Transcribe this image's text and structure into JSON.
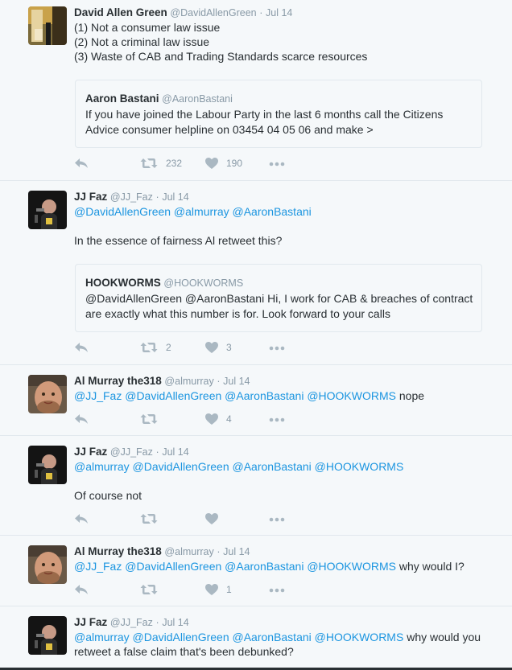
{
  "tweets": [
    {
      "name": "David Allen Green",
      "handle": "@DavidAllenGreen",
      "date": "Jul 14",
      "lines": [
        "(1) Not a consumer law issue",
        "(2) Not a criminal law issue",
        "(3) Waste of CAB and Trading Standards scarce resources"
      ],
      "quote": {
        "name": "Aaron Bastani",
        "handle": "@AaronBastani",
        "lines": [
          "If you have joined the Labour Party in the last 6 months call the Citizens",
          "Advice consumer helpline on 03454 04 05 06 and make >"
        ]
      },
      "retweets": "232",
      "likes": "190"
    },
    {
      "name": "JJ Faz",
      "handle": "@JJ_Faz",
      "date": "Jul 14",
      "mentions": "@DavidAllenGreen @almurray @AaronBastani",
      "text": "In the essence of fairness Al retweet this?",
      "quote": {
        "name": "HOOKWORMS",
        "handle": "@HOOKWORMS",
        "lines": [
          "@DavidAllenGreen @AaronBastani Hi, I work for CAB & breaches of contract",
          "are exactly what this number is for. Look forward to your calls"
        ]
      },
      "retweets": "2",
      "likes": "3"
    },
    {
      "name": "Al Murray the318",
      "handle": "@almurray",
      "date": "Jul 14",
      "mentions": "@JJ_Faz @DavidAllenGreen @AaronBastani @HOOKWORMS",
      "text": "nope",
      "retweets": "",
      "likes": "4"
    },
    {
      "name": "JJ Faz",
      "handle": "@JJ_Faz",
      "date": "Jul 14",
      "mentions": "@almurray @DavidAllenGreen @AaronBastani @HOOKWORMS",
      "text": "Of course not",
      "retweets": "",
      "likes": ""
    },
    {
      "name": "Al Murray the318",
      "handle": "@almurray",
      "date": "Jul 14",
      "mentions": "@JJ_Faz @DavidAllenGreen @AaronBastani @HOOKWORMS",
      "text": "why would I?",
      "retweets": "",
      "likes": "1"
    },
    {
      "name": "JJ Faz",
      "handle": "@JJ_Faz",
      "date": "Jul 14",
      "mentions": "@almurray @DavidAllenGreen @AaronBastani @HOOKWORMS",
      "text": "why would you",
      "text_line2": "retweet a false claim that's been debunked?"
    }
  ],
  "separator": "·",
  "colors": {
    "link": "#1b95e0",
    "muted": "#8899a6",
    "icon": "#aab8c2",
    "border": "#e1e8ed"
  },
  "icons": [
    "reply-icon",
    "retweet-icon",
    "heart-icon",
    "more-icon"
  ]
}
